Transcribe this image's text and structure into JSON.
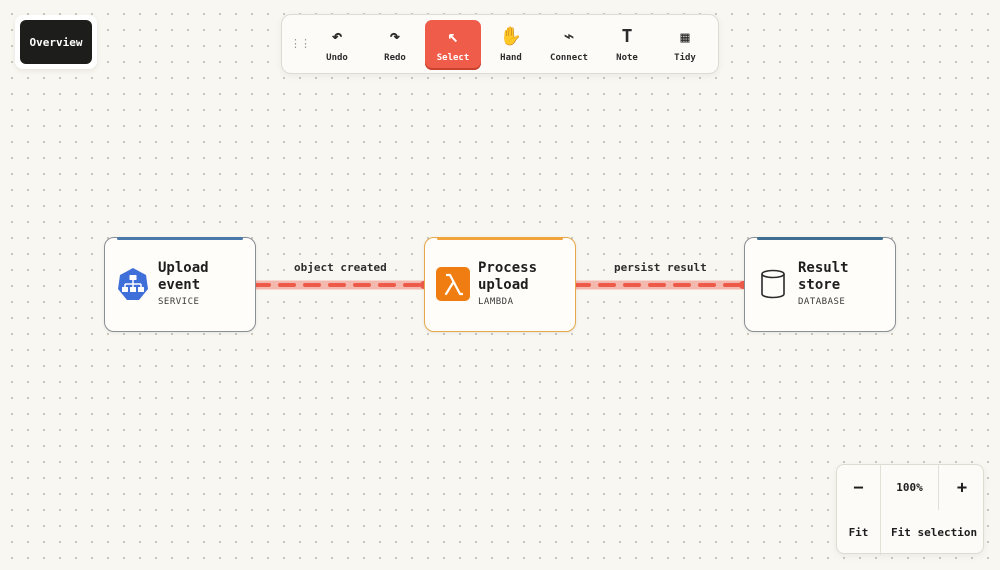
{
  "overview": {
    "label": "Overview"
  },
  "toolbar": {
    "handle": "⋮⋮",
    "tools": [
      {
        "id": "undo",
        "label": "Undo",
        "icon": "↶",
        "icon_name": "undo-icon",
        "active": false
      },
      {
        "id": "redo",
        "label": "Redo",
        "icon": "↷",
        "icon_name": "redo-icon",
        "active": false
      },
      {
        "id": "select",
        "label": "Select",
        "icon": "↖",
        "icon_name": "select-cursor-icon",
        "active": true
      },
      {
        "id": "hand",
        "label": "Hand",
        "icon": "✋",
        "icon_name": "hand-icon",
        "active": false
      },
      {
        "id": "connect",
        "label": "Connect",
        "icon": "⌁",
        "icon_name": "connect-icon",
        "active": false
      },
      {
        "id": "note",
        "label": "Note",
        "icon": "T",
        "icon_name": "note-text-icon",
        "active": false
      },
      {
        "id": "tidy",
        "label": "Tidy",
        "icon": "▦",
        "icon_name": "tidy-grid-icon",
        "active": false
      }
    ]
  },
  "nodes": [
    {
      "id": "upload",
      "title_line1": "Upload",
      "title_line2": "event",
      "kind": "SERVICE",
      "accent": "#4a78a8",
      "icon": "sitemap-icon",
      "icon_color": "#3f6fd8"
    },
    {
      "id": "process",
      "title_line1": "Process",
      "title_line2": "upload",
      "kind": "LAMBDA",
      "accent": "#f0a43a",
      "icon": "lambda-icon",
      "icon_color": "#f07d12"
    },
    {
      "id": "store",
      "title_line1": "Result",
      "title_line2": "store",
      "kind": "DATABASE",
      "accent": "#3f6e92",
      "icon": "database-icon",
      "icon_color": "#2b2b2b"
    }
  ],
  "edges": [
    {
      "from": "upload",
      "to": "process",
      "label": "object created",
      "color": "#ee5a4a"
    },
    {
      "from": "process",
      "to": "store",
      "label": "persist result",
      "color": "#ee5a4a"
    }
  ],
  "zoom": {
    "minus": "−",
    "level": "100%",
    "plus": "+",
    "fit": "Fit",
    "fit_selection": "Fit selection"
  }
}
